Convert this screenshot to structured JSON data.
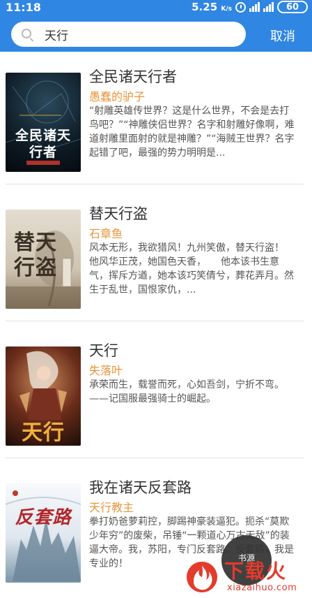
{
  "status_bar": {
    "time": "11:18",
    "net_speed": "5.25",
    "net_unit": "K/s",
    "signal_1": "4G",
    "battery": "60"
  },
  "search": {
    "value": "天行",
    "cancel_label": "取消"
  },
  "books": [
    {
      "title": "全民诸天行者",
      "author": "愚蠢的驴子",
      "description": "“射雕英雄传世界？这是什么世界，不会是去打鸟吧？”“神雕侠侣世界？名字和射雕好像啊，难道射雕里面射的就是神雕？”“海贼王世界？名字起错了吧，最强的势力明明是...",
      "cover_text": "全民诸天行者",
      "cover_color": "#0e1a24"
    },
    {
      "title": "替天行盗",
      "author": "石章鱼",
      "description": "风本无形，我欲猎风！九州笑傲，替天行盗！　　他风华正茂，她国色天香，　　他本该书生意气，挥斥方遒，她本该巧笑倩兮，葬花弄月。然生于乱世，国恨家仇，...",
      "cover_text": "替天行盗",
      "cover_color": "#d9d2c4"
    },
    {
      "title": "天行",
      "author": "失落叶",
      "description": "承荣而生，载誉而死，心如吾剑，宁折不弯。——记国服最强骑士的崛起。",
      "cover_text": "天行",
      "cover_color": "#3a1d14"
    },
    {
      "title": "我在诸天反套路",
      "author": "天行教主",
      "description": "拳打奶爸萝莉控，脚踢神豪装逼犯。扼杀“莫欺少年穷”的废柴，吊锤“一颗道心万古无敌”的装逼大帝。我，苏阳，专门反套路。反套路，我是专业的！",
      "cover_text": "反套路",
      "cover_color": "#e9eef2"
    }
  ],
  "watermark": {
    "brand": "下载火",
    "url": "xiazaihuo.com",
    "fab_label": "书源"
  },
  "colors": {
    "header": "#2f86e3",
    "author": "#e8953a",
    "watermark": "#e33b2c"
  }
}
